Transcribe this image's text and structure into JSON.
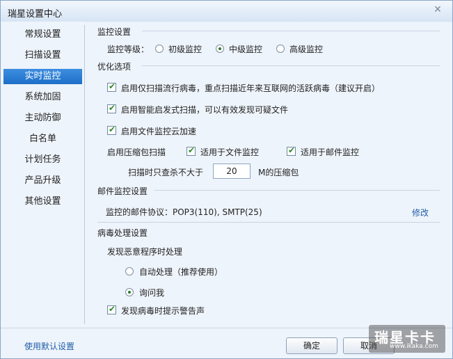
{
  "window": {
    "title": "瑞星设置中心",
    "close_glyph": "✕"
  },
  "sidebar": {
    "items": [
      {
        "label": "常规设置"
      },
      {
        "label": "扫描设置"
      },
      {
        "label": "实时监控"
      },
      {
        "label": "系统加固"
      },
      {
        "label": "主动防御"
      },
      {
        "label": "白名单"
      },
      {
        "label": "计划任务"
      },
      {
        "label": "产品升级"
      },
      {
        "label": "其他设置"
      }
    ],
    "active_index": 2
  },
  "monitor": {
    "section_title": "监控设置",
    "level_label": "监控等级：",
    "levels": [
      {
        "label": "初级监控",
        "checked": false
      },
      {
        "label": "中级监控",
        "checked": true
      },
      {
        "label": "高级监控",
        "checked": false
      }
    ]
  },
  "optimize": {
    "section_title": "优化选项",
    "options": [
      {
        "label": "启用仅扫描流行病毒，重点扫描近年来互联网的活跃病毒（建议开启）",
        "checked": true
      },
      {
        "label": "启用智能启发式扫描，可以有效发现可疑文件",
        "checked": true
      },
      {
        "label": "启用文件监控云加速",
        "checked": true
      }
    ],
    "compress": {
      "label": "启用压缩包扫描",
      "file_monitor": {
        "label": "适用于文件监控",
        "checked": true
      },
      "mail_monitor": {
        "label": "适用于邮件监控",
        "checked": true
      },
      "size_prefix": "扫描时只查杀不大于",
      "size_value": "20",
      "size_suffix": "M的压缩包"
    }
  },
  "mail": {
    "section_title": "邮件监控设置",
    "protocol_text": "监控的邮件协议：POP3(110), SMTP(25)",
    "modify_label": "修改"
  },
  "virus": {
    "section_title": "病毒处理设置",
    "subheading": "发现恶意程序时处理",
    "actions": [
      {
        "label": "自动处理（推荐使用）",
        "checked": false
      },
      {
        "label": "询问我",
        "checked": true
      }
    ],
    "alert": {
      "label": "发现病毒时提示警告声",
      "checked": true
    }
  },
  "footer": {
    "default_link": "使用默认设置",
    "ok_label": "确定",
    "cancel_label": "取消"
  },
  "watermark": {
    "main": "瑞星卡卡",
    "sub": "www.ikaka.com"
  }
}
